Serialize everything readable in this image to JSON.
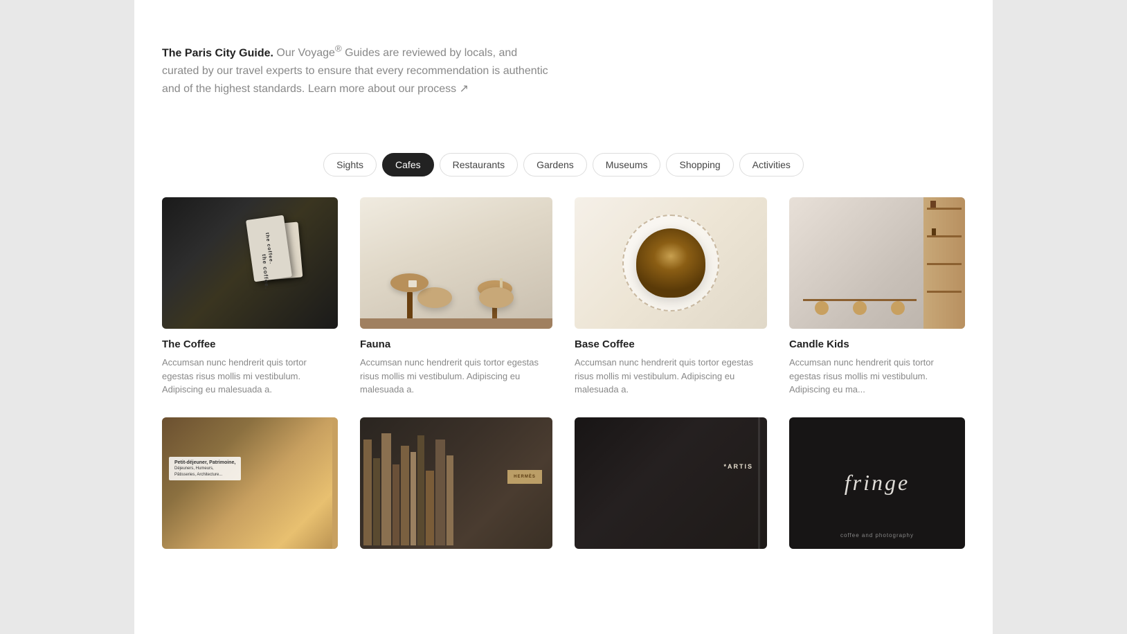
{
  "page": {
    "title": "The Paris City Guide.",
    "intro_text": "Our Voyage® Guides are reviewed by locals, and curated by our travel experts to ensure that every recommendation is authentic and of the highest standards.",
    "learn_more_link": "Learn more about our process ↗"
  },
  "filter_tabs": [
    {
      "id": "sights",
      "label": "Sights",
      "active": false
    },
    {
      "id": "cafes",
      "label": "Cafes",
      "active": true
    },
    {
      "id": "restaurants",
      "label": "Restaurants",
      "active": false
    },
    {
      "id": "gardens",
      "label": "Gardens",
      "active": false
    },
    {
      "id": "museums",
      "label": "Museums",
      "active": false
    },
    {
      "id": "shopping",
      "label": "Shopping",
      "active": false
    },
    {
      "id": "activities",
      "label": "Activities",
      "active": false
    }
  ],
  "cards_row1": [
    {
      "id": "the-coffee",
      "title": "The Coffee",
      "description": "Accumsan nunc hendrerit quis tortor egestas risus mollis mi vestibulum. Adipiscing eu malesuada a.",
      "image_type": "the-coffee"
    },
    {
      "id": "fauna",
      "title": "Fauna",
      "description": "Accumsan nunc hendrerit quis tortor egestas risus mollis mi vestibulum. Adipiscing eu malesuada a.",
      "image_type": "fauna"
    },
    {
      "id": "base-coffee",
      "title": "Base Coffee",
      "description": "Accumsan nunc hendrerit quis tortor egestas risus mollis mi vestibulum. Adipiscing eu malesuada a.",
      "image_type": "base-coffee"
    },
    {
      "id": "candle-kids",
      "title": "Candle Kids",
      "description": "Accumsan nunc hendrerit quis tortor egestas risus mollis mi vestibulum. Adipiscing eu ma...",
      "image_type": "candle-kids"
    }
  ],
  "cards_row2": [
    {
      "id": "card-second-1",
      "title": "",
      "description": "",
      "image_type": "second-1"
    },
    {
      "id": "card-second-2",
      "title": "",
      "description": "",
      "image_type": "second-2"
    },
    {
      "id": "card-second-3",
      "title": "",
      "description": "",
      "image_type": "second-3"
    },
    {
      "id": "card-second-4",
      "title": "",
      "description": "",
      "image_type": "second-4"
    }
  ]
}
